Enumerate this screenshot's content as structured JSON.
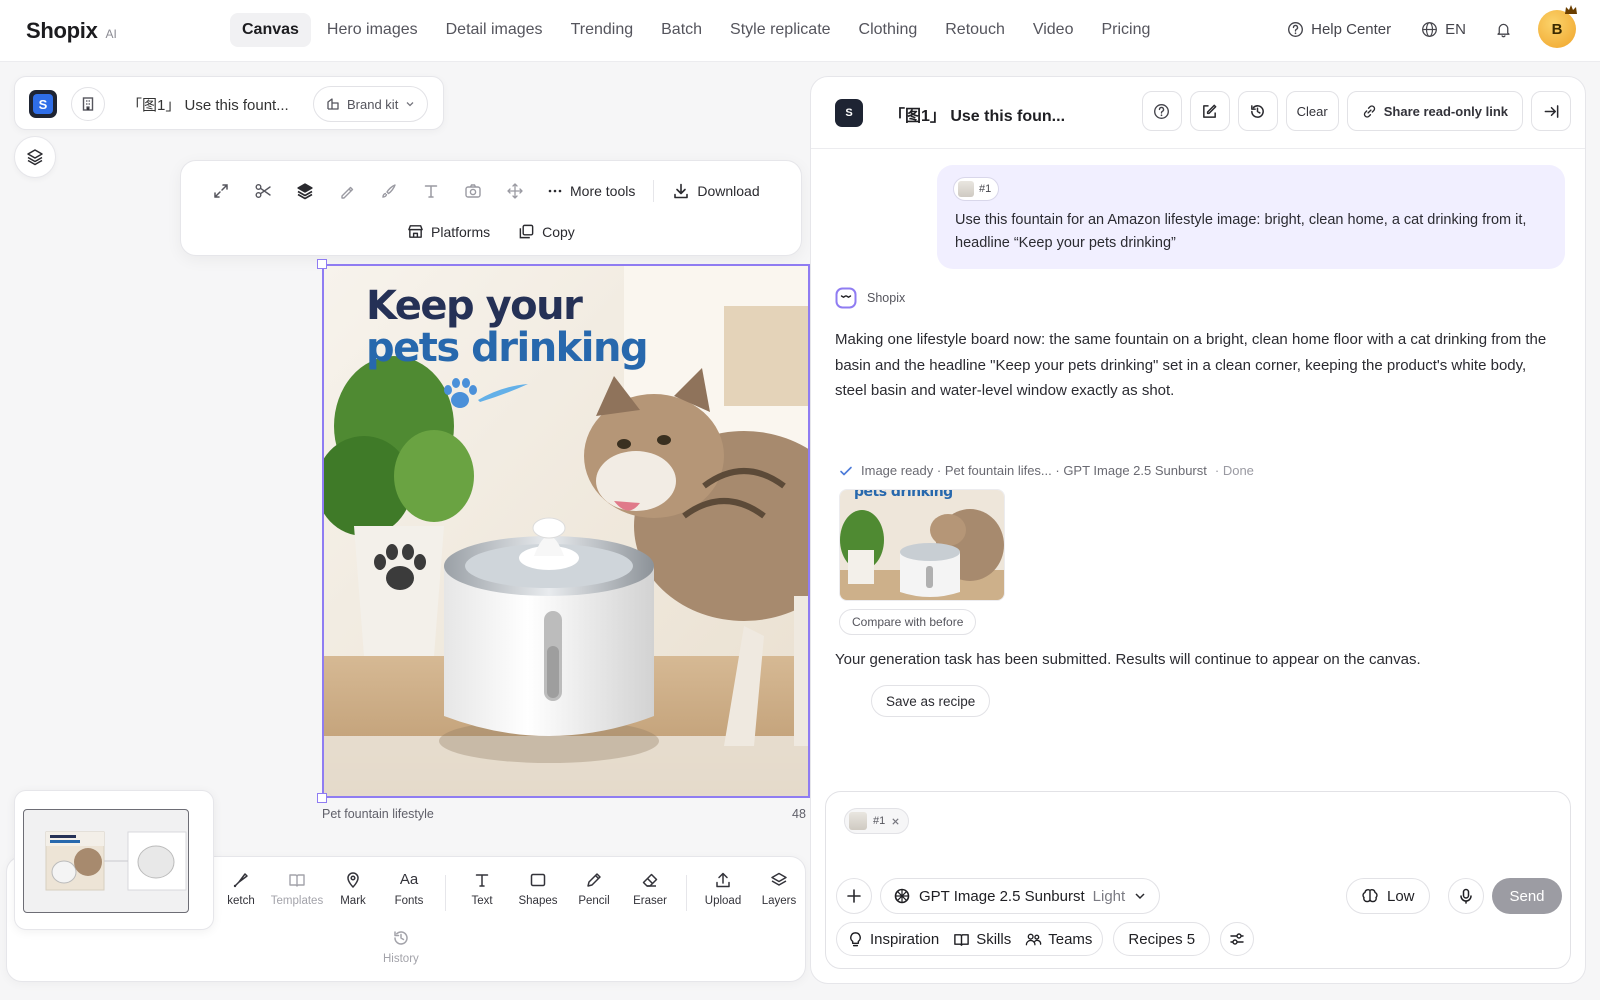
{
  "app": {
    "name": "Shopix",
    "badge": "AI"
  },
  "nav": {
    "tabs": [
      "Canvas",
      "Hero images",
      "Detail images",
      "Trending",
      "Batch",
      "Style replicate",
      "Clothing",
      "Retouch",
      "Video",
      "Pricing"
    ],
    "active_tab": "Canvas",
    "help": "Help Center",
    "language": "EN",
    "avatar_initial": "B"
  },
  "project": {
    "logo_letter": "S",
    "title": "「图1」 Use this fount...",
    "brand_kit": "Brand kit"
  },
  "toolbar": {
    "more_tools": "More tools",
    "download": "Download",
    "platforms": "Platforms",
    "copy": "Copy"
  },
  "artboard": {
    "headline_line1": "Keep your",
    "headline_line2": "pets drinking",
    "caption": "Pet fountain lifestyle",
    "size_label": "48"
  },
  "bottom_tools": {
    "items": [
      "ketch",
      "Templates",
      "Mark",
      "Fonts",
      "Text",
      "Shapes",
      "Pencil",
      "Eraser",
      "Upload",
      "Layers"
    ],
    "history": "History",
    "fonts_glyph": "Aa"
  },
  "chat": {
    "title": "「图1」 Use this foun...",
    "clear": "Clear",
    "share": "Share read-only link",
    "user_message": {
      "ref": "#1",
      "text": "Use this fountain for an Amazon lifestyle image: bright, clean home, a cat drinking from it, headline “Keep your pets drinking”"
    },
    "bot_name": "Shopix",
    "bot_text": "Making one lifestyle board now: the same fountain on a bright, clean home floor with a cat drinking from the basin and the headline \"Keep your pets drinking\" set in a clean corner, keeping the product's white body, steel basin and water-level window exactly as shot.",
    "status": {
      "text": "Image ready · Pet fountain lifes... · GPT Image 2.5 Sunburst",
      "state": "· Done"
    },
    "thumb_text": "pets drinking",
    "compare": "Compare with before",
    "submitted": "Your generation task has been submitted. Results will continue to appear on the canvas.",
    "save_recipe": "Save as recipe"
  },
  "composer": {
    "ref_chip": "#1",
    "model": "GPT Image 2.5 Sunburst",
    "mode": "Light",
    "quality": "Low",
    "send": "Send",
    "inspiration": "Inspiration",
    "skills": "Skills",
    "teams": "Teams",
    "recipes": "Recipes 5"
  },
  "colors": {
    "accent": "#8f7cf2",
    "headline_navy": "#253156",
    "headline_blue": "#2768ad",
    "user_bubble": "#f1efff"
  }
}
